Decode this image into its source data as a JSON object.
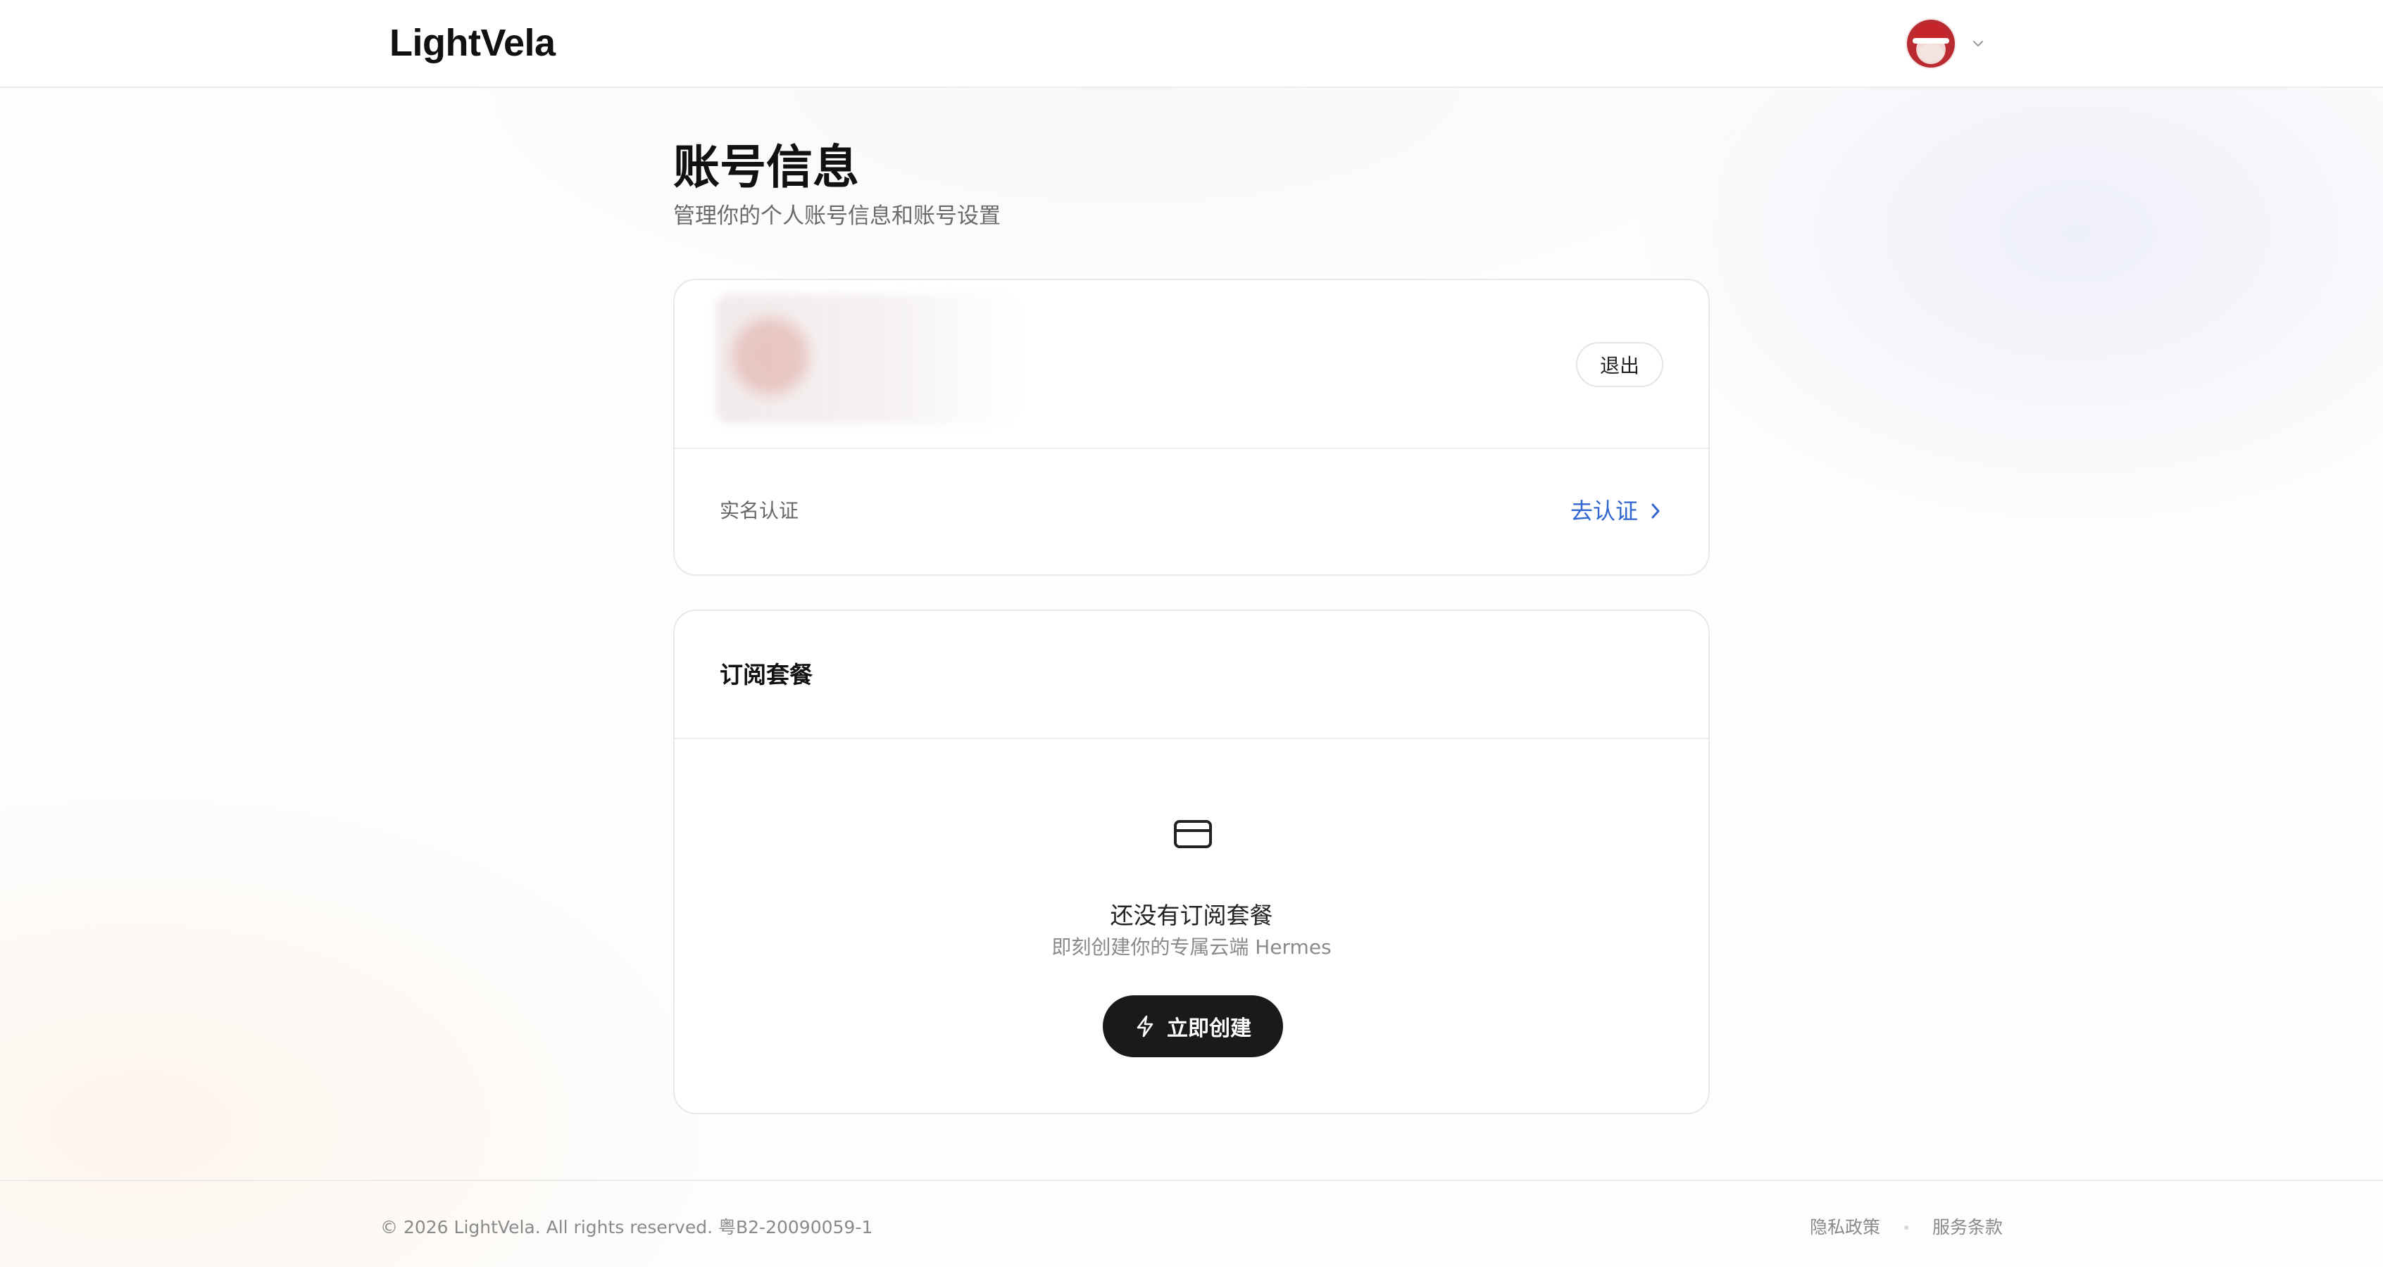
{
  "header": {
    "logo_text": "LightVela",
    "user_menu": {
      "avatar_icon": "santa-avatar",
      "chevron_icon": "chevron-down-icon"
    }
  },
  "page": {
    "title": "账号信息",
    "subtitle": "管理你的个人账号信息和账号设置"
  },
  "account_card": {
    "logout_label": "退出",
    "verification": {
      "label": "实名认证",
      "action_label": "去认证",
      "action_icon": "chevron-right-icon",
      "action_color": "#2f66d0"
    }
  },
  "subscription_card": {
    "title": "订阅套餐",
    "empty_state": {
      "icon": "credit-card-icon",
      "title": "还没有订阅套餐",
      "subtitle": "即刻创建你的专属云端 Hermes",
      "button_label": "立即创建",
      "button_icon": "lightning-icon"
    }
  },
  "footer": {
    "copyright": "© 2026 LightVela. All rights reserved. 粤B2-20090059-1",
    "links": [
      {
        "label": "隐私政策"
      },
      {
        "label": "服务条款"
      }
    ]
  }
}
